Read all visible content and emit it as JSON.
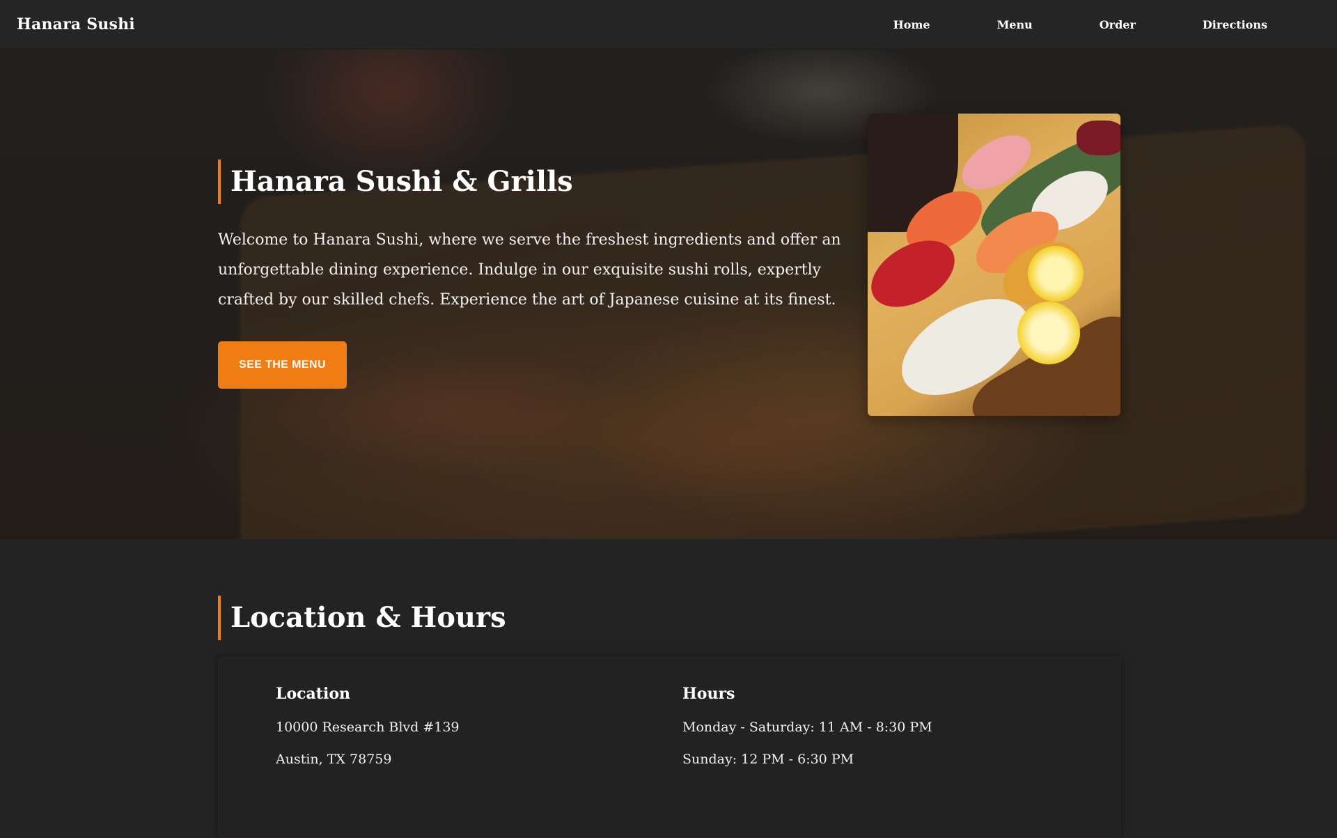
{
  "nav": {
    "brand": "Hanara Sushi",
    "links": [
      "Home",
      "Menu",
      "Order",
      "Directions"
    ]
  },
  "hero": {
    "title": "Hanara Sushi & Grills",
    "description": "Welcome to Hanara Sushi, where we serve the freshest ingredients and offer an unforgettable dining experience. Indulge in our exquisite sushi rolls, expertly crafted by our skilled chefs. Experience the art of Japanese cuisine at its finest.",
    "cta_label": "SEE THE MENU"
  },
  "location_hours": {
    "title": "Location & Hours",
    "location": {
      "heading": "Location",
      "lines": [
        "10000 Research Blvd #139",
        "Austin, TX 78759"
      ]
    },
    "hours": {
      "heading": "Hours",
      "lines": [
        "Monday - Saturday: 11 AM - 8:30 PM",
        "Sunday: 12 PM - 6:30 PM"
      ]
    }
  },
  "colors": {
    "accent": "#f07d13",
    "background": "#232323",
    "nav_background": "#252525"
  }
}
